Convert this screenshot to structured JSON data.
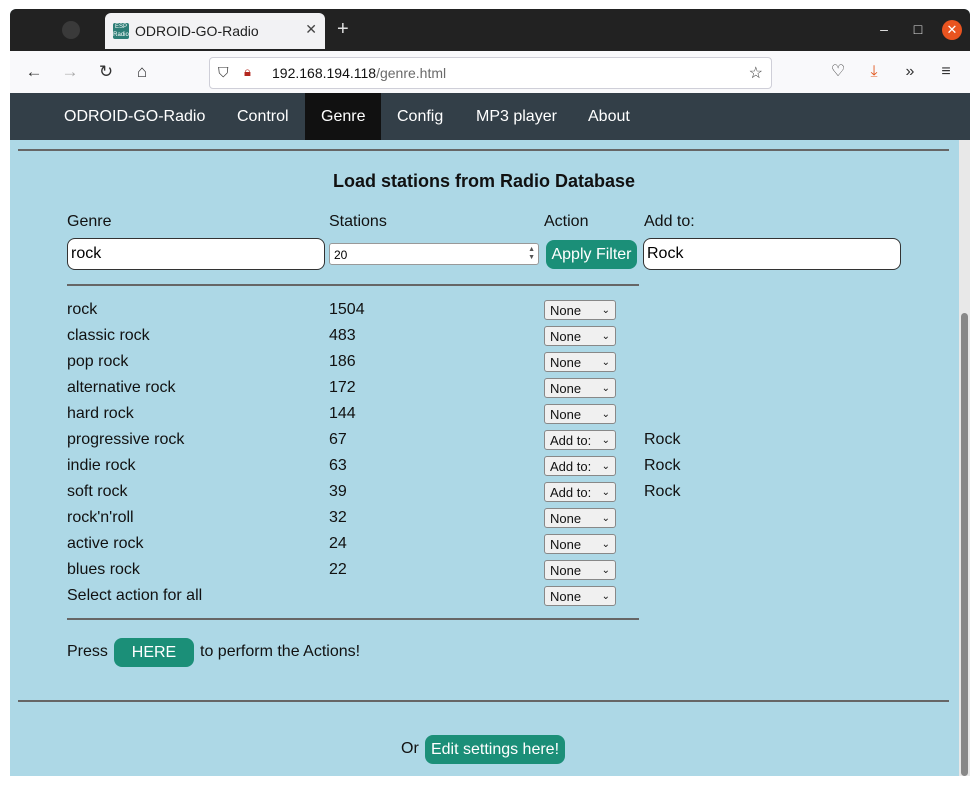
{
  "browser": {
    "tab_title": "ODROID-GO-Radio",
    "new_tab": "+",
    "url_host": "192.168.194.118",
    "url_path": "/genre.html"
  },
  "nav": {
    "items": [
      "ODROID-GO-Radio",
      "Control",
      "Genre",
      "Config",
      "MP3 player",
      "About"
    ],
    "active": "Genre"
  },
  "page": {
    "heading": "Load stations from Radio Database",
    "col_genre": "Genre",
    "col_stations": "Stations",
    "col_action": "Action",
    "col_add": "Add to:",
    "genre_value": "rock",
    "stations_value": "20",
    "apply_label": "Apply Filter",
    "add_value": "Rock",
    "rows": [
      {
        "genre": "rock",
        "count": "1504",
        "action": "None",
        "add": ""
      },
      {
        "genre": "classic rock",
        "count": "483",
        "action": "None",
        "add": ""
      },
      {
        "genre": "pop rock",
        "count": "186",
        "action": "None",
        "add": ""
      },
      {
        "genre": "alternative rock",
        "count": "172",
        "action": "None",
        "add": ""
      },
      {
        "genre": "hard rock",
        "count": "144",
        "action": "None",
        "add": ""
      },
      {
        "genre": "progressive rock",
        "count": "67",
        "action": "Add to:",
        "add": "Rock"
      },
      {
        "genre": "indie rock",
        "count": "63",
        "action": "Add to:",
        "add": "Rock"
      },
      {
        "genre": "soft rock",
        "count": "39",
        "action": "Add to:",
        "add": "Rock"
      },
      {
        "genre": "rock'n'roll",
        "count": "32",
        "action": "None",
        "add": ""
      },
      {
        "genre": "active rock",
        "count": "24",
        "action": "None",
        "add": ""
      },
      {
        "genre": "blues rock",
        "count": "22",
        "action": "None",
        "add": ""
      }
    ],
    "select_all_label": "Select action for all",
    "select_all_value": "None",
    "press_label": "Press",
    "here_label": "HERE",
    "perform_label": "to perform the Actions!",
    "or_label": "Or",
    "edit_label": "Edit settings here!"
  },
  "colors": {
    "page_bg": "#add8e6",
    "navbar_bg": "#333f48",
    "accent_green": "#1b8f78"
  }
}
